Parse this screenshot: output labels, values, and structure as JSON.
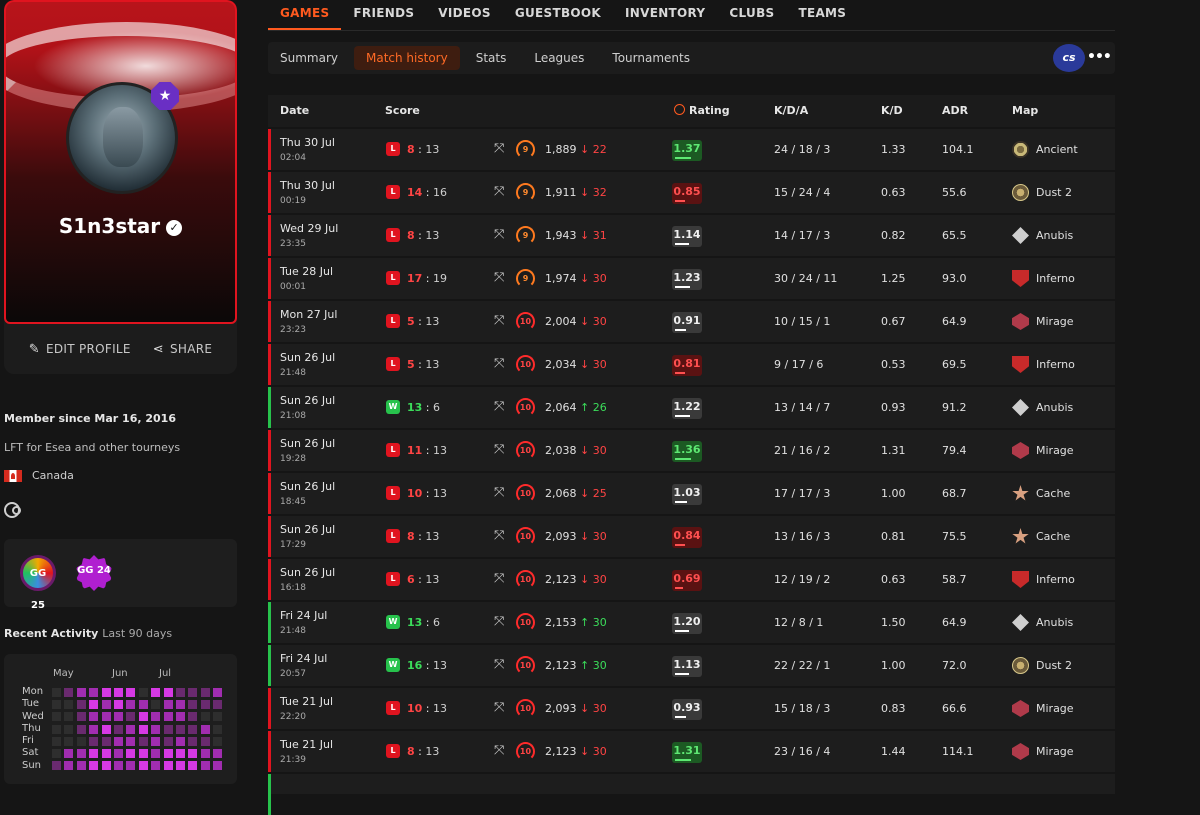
{
  "profile": {
    "username": "S1n3star",
    "level_badge": "★",
    "edit_label": "EDIT PROFILE",
    "share_label": "SHARE",
    "member_since": "Member since Mar 16, 2016",
    "bio": "LFT for Esea and other tourneys",
    "country": "Canada",
    "badges": [
      "GG 25",
      "GG 24"
    ]
  },
  "activity": {
    "title": "Recent Activity",
    "subtitle": "Last 90 days",
    "months": [
      "May",
      "Jun",
      "Jul"
    ],
    "days": [
      "Mon",
      "Tue",
      "Wed",
      "Thu",
      "Fri",
      "Sat",
      "Sun"
    ]
  },
  "nav": {
    "tabs": [
      "GAMES",
      "FRIENDS",
      "VIDEOS",
      "GUESTBOOK",
      "INVENTORY",
      "CLUBS",
      "TEAMS"
    ],
    "active": "GAMES"
  },
  "subnav": {
    "tabs": [
      "Summary",
      "Match history",
      "Stats",
      "Leagues",
      "Tournaments"
    ],
    "active": "Match history",
    "game_logo": "cs",
    "more": "•••"
  },
  "table": {
    "headers": {
      "date": "Date",
      "score": "Score",
      "rating": "Rating",
      "kda": "K/D/A",
      "kd": "K/D",
      "adr": "ADR",
      "map": "Map"
    },
    "rows": [
      {
        "date": "Thu 30 Jul",
        "time": "02:04",
        "result": "L",
        "mine": "8",
        "opp": "13",
        "level": "9",
        "elo": "1,889",
        "delta": "↓ 22",
        "dir": "down",
        "rating": "1.37",
        "rclass": "good",
        "kda": "24 / 18 / 3",
        "kd": "1.33",
        "adr": "104.1",
        "map": "Ancient"
      },
      {
        "date": "Thu 30 Jul",
        "time": "00:19",
        "result": "L",
        "mine": "14",
        "opp": "16",
        "level": "9",
        "elo": "1,911",
        "delta": "↓ 32",
        "dir": "down",
        "rating": "0.85",
        "rclass": "bad",
        "kda": "15 / 24 / 4",
        "kd": "0.63",
        "adr": "55.6",
        "map": "Dust 2"
      },
      {
        "date": "Wed 29 Jul",
        "time": "23:35",
        "result": "L",
        "mine": "8",
        "opp": "13",
        "level": "9",
        "elo": "1,943",
        "delta": "↓ 31",
        "dir": "down",
        "rating": "1.14",
        "rclass": "mid",
        "kda": "14 / 17 / 3",
        "kd": "0.82",
        "adr": "65.5",
        "map": "Anubis"
      },
      {
        "date": "Tue 28 Jul",
        "time": "00:01",
        "result": "L",
        "mine": "17",
        "opp": "19",
        "level": "9",
        "elo": "1,974",
        "delta": "↓ 30",
        "dir": "down",
        "rating": "1.23",
        "rclass": "mid",
        "kda": "30 / 24 / 11",
        "kd": "1.25",
        "adr": "93.0",
        "map": "Inferno"
      },
      {
        "date": "Mon 27 Jul",
        "time": "23:23",
        "result": "L",
        "mine": "5",
        "opp": "13",
        "level": "10",
        "elo": "2,004",
        "delta": "↓ 30",
        "dir": "down",
        "rating": "0.91",
        "rclass": "mid",
        "kda": "10 / 15 / 1",
        "kd": "0.67",
        "adr": "64.9",
        "map": "Mirage"
      },
      {
        "date": "Sun 26 Jul",
        "time": "21:48",
        "result": "L",
        "mine": "5",
        "opp": "13",
        "level": "10",
        "elo": "2,034",
        "delta": "↓ 30",
        "dir": "down",
        "rating": "0.81",
        "rclass": "bad",
        "kda": "9 / 17 / 6",
        "kd": "0.53",
        "adr": "69.5",
        "map": "Inferno"
      },
      {
        "date": "Sun 26 Jul",
        "time": "21:08",
        "result": "W",
        "mine": "13",
        "opp": "6",
        "level": "10",
        "elo": "2,064",
        "delta": "↑ 26",
        "dir": "up",
        "rating": "1.22",
        "rclass": "mid",
        "kda": "13 / 14 / 7",
        "kd": "0.93",
        "adr": "91.2",
        "map": "Anubis"
      },
      {
        "date": "Sun 26 Jul",
        "time": "19:28",
        "result": "L",
        "mine": "11",
        "opp": "13",
        "level": "10",
        "elo": "2,038",
        "delta": "↓ 30",
        "dir": "down",
        "rating": "1.36",
        "rclass": "good",
        "kda": "21 / 16 / 2",
        "kd": "1.31",
        "adr": "79.4",
        "map": "Mirage"
      },
      {
        "date": "Sun 26 Jul",
        "time": "18:45",
        "result": "L",
        "mine": "10",
        "opp": "13",
        "level": "10",
        "elo": "2,068",
        "delta": "↓ 25",
        "dir": "down",
        "rating": "1.03",
        "rclass": "mid",
        "kda": "17 / 17 / 3",
        "kd": "1.00",
        "adr": "68.7",
        "map": "Cache"
      },
      {
        "date": "Sun 26 Jul",
        "time": "17:29",
        "result": "L",
        "mine": "8",
        "opp": "13",
        "level": "10",
        "elo": "2,093",
        "delta": "↓ 30",
        "dir": "down",
        "rating": "0.84",
        "rclass": "bad",
        "kda": "13 / 16 / 3",
        "kd": "0.81",
        "adr": "75.5",
        "map": "Cache"
      },
      {
        "date": "Sun 26 Jul",
        "time": "16:18",
        "result": "L",
        "mine": "6",
        "opp": "13",
        "level": "10",
        "elo": "2,123",
        "delta": "↓ 30",
        "dir": "down",
        "rating": "0.69",
        "rclass": "bad",
        "kda": "12 / 19 / 2",
        "kd": "0.63",
        "adr": "58.7",
        "map": "Inferno"
      },
      {
        "date": "Fri 24 Jul",
        "time": "21:48",
        "result": "W",
        "mine": "13",
        "opp": "6",
        "level": "10",
        "elo": "2,153",
        "delta": "↑ 30",
        "dir": "up",
        "rating": "1.20",
        "rclass": "mid",
        "kda": "12 / 8 / 1",
        "kd": "1.50",
        "adr": "64.9",
        "map": "Anubis"
      },
      {
        "date": "Fri 24 Jul",
        "time": "20:57",
        "result": "W",
        "mine": "16",
        "opp": "13",
        "level": "10",
        "elo": "2,123",
        "delta": "↑ 30",
        "dir": "up",
        "rating": "1.13",
        "rclass": "mid",
        "kda": "22 / 22 / 1",
        "kd": "1.00",
        "adr": "72.0",
        "map": "Dust 2"
      },
      {
        "date": "Tue 21 Jul",
        "time": "22:20",
        "result": "L",
        "mine": "10",
        "opp": "13",
        "level": "10",
        "elo": "2,093",
        "delta": "↓ 30",
        "dir": "down",
        "rating": "0.93",
        "rclass": "mid",
        "kda": "15 / 18 / 3",
        "kd": "0.83",
        "adr": "66.6",
        "map": "Mirage"
      },
      {
        "date": "Tue 21 Jul",
        "time": "21:39",
        "result": "L",
        "mine": "8",
        "opp": "13",
        "level": "10",
        "elo": "2,123",
        "delta": "↓ 30",
        "dir": "down",
        "rating": "1.31",
        "rclass": "good",
        "kda": "23 / 16 / 4",
        "kd": "1.44",
        "adr": "114.1",
        "map": "Mirage"
      }
    ]
  }
}
